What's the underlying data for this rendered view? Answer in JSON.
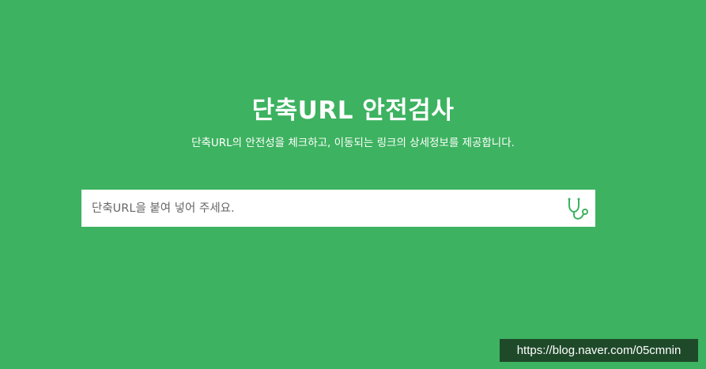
{
  "header": {
    "title": "단축URL 안전검사",
    "subtitle": "단축URL의 안전성을 체크하고, 이동되는 링크의 상세정보를 제공합니다."
  },
  "search": {
    "placeholder": "단축URL을 붙여 넣어 주세요.",
    "value": "",
    "submit_icon": "stethoscope-icon"
  },
  "watermark": {
    "text": "https://blog.naver.com/05cmnin"
  },
  "colors": {
    "background": "#3db260",
    "accent": "#3db260",
    "watermark_bg": "#1f4a2a"
  }
}
